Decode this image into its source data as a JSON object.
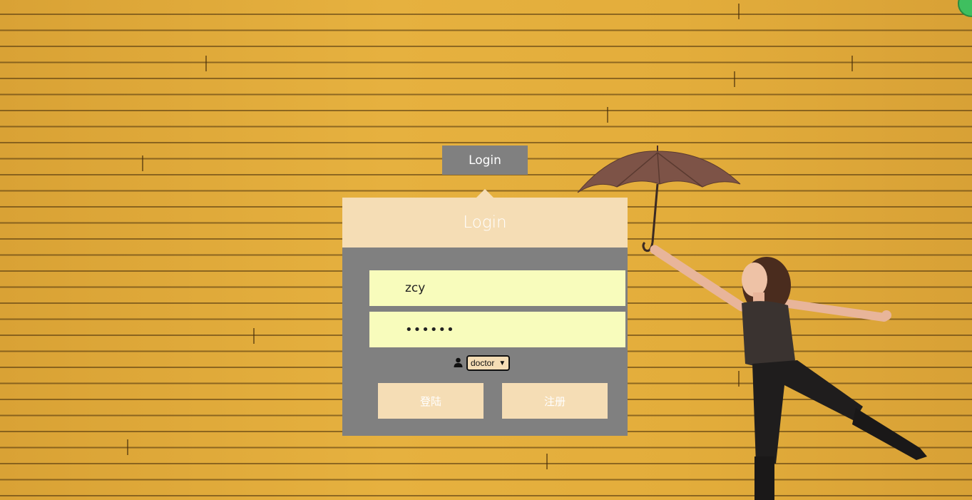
{
  "header": {
    "tab_label": "Login"
  },
  "panel": {
    "title": "Login"
  },
  "form": {
    "username_value": "zcy",
    "password_masked": "••••••",
    "role_selected": "doctor",
    "role_arrow": "▼",
    "login_button": "登陆",
    "register_button": "注册"
  },
  "icons": {
    "role_icon": "user-icon",
    "select_icon": "chevron-down-icon"
  },
  "colors": {
    "tab_bg": "#808080",
    "panel_head_bg": "#f5ddb5",
    "panel_body_bg": "#808080",
    "input_bg": "#f8fcbc",
    "button_bg": "#f5ddb5",
    "background_wall": "#e2ad3a"
  }
}
